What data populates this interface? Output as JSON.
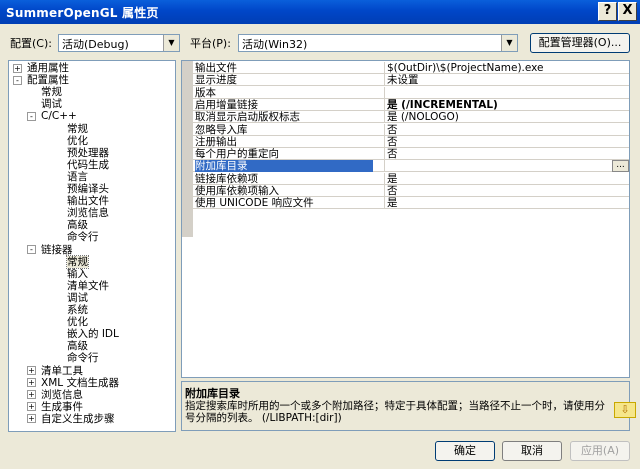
{
  "window": {
    "title": "SummerOpenGL 属性页",
    "help_label": "?",
    "close_label": "X"
  },
  "toolbar": {
    "config_label": "配置(C):",
    "config_value": "活动(Debug)",
    "platform_label": "平台(P):",
    "platform_value": "活动(Win32)",
    "config_manager_label": "配置管理器(O)..."
  },
  "tree": {
    "items": [
      {
        "label": "通用属性",
        "level": 0,
        "expander": "+"
      },
      {
        "label": "配置属性",
        "level": 0,
        "expander": "-"
      },
      {
        "label": "常规",
        "level": 1
      },
      {
        "label": "调试",
        "level": 1
      },
      {
        "label": "C/C++",
        "level": 1,
        "expander": "-"
      },
      {
        "label": "常规",
        "level": 2
      },
      {
        "label": "优化",
        "level": 2
      },
      {
        "label": "预处理器",
        "level": 2
      },
      {
        "label": "代码生成",
        "level": 2
      },
      {
        "label": "语言",
        "level": 2
      },
      {
        "label": "预编译头",
        "level": 2
      },
      {
        "label": "输出文件",
        "level": 2
      },
      {
        "label": "浏览信息",
        "level": 2
      },
      {
        "label": "高级",
        "level": 2
      },
      {
        "label": "命令行",
        "level": 2
      },
      {
        "label": "链接器",
        "level": 1,
        "expander": "-"
      },
      {
        "label": "常规",
        "level": 2,
        "selected": true
      },
      {
        "label": "输入",
        "level": 2
      },
      {
        "label": "清单文件",
        "level": 2
      },
      {
        "label": "调试",
        "level": 2
      },
      {
        "label": "系统",
        "level": 2
      },
      {
        "label": "优化",
        "level": 2
      },
      {
        "label": "嵌入的 IDL",
        "level": 2
      },
      {
        "label": "高级",
        "level": 2
      },
      {
        "label": "命令行",
        "level": 2
      },
      {
        "label": "清单工具",
        "level": 1,
        "expander": "+"
      },
      {
        "label": "XML 文档生成器",
        "level": 1,
        "expander": "+"
      },
      {
        "label": "浏览信息",
        "level": 1,
        "expander": "+"
      },
      {
        "label": "生成事件",
        "level": 1,
        "expander": "+"
      },
      {
        "label": "自定义生成步骤",
        "level": 1,
        "expander": "+"
      }
    ]
  },
  "grid": {
    "rows": [
      {
        "name": "输出文件",
        "value": "$(OutDir)\\$(ProjectName).exe"
      },
      {
        "name": "显示进度",
        "value": "未设置"
      },
      {
        "name": "版本",
        "value": ""
      },
      {
        "name": "启用增量链接",
        "value": "是 (/INCREMENTAL)",
        "bold": true
      },
      {
        "name": "取消显示启动版权标志",
        "value": "是 (/NOLOGO)"
      },
      {
        "name": "忽略导入库",
        "value": "否"
      },
      {
        "name": "注册输出",
        "value": "否"
      },
      {
        "name": "每个用户的重定向",
        "value": "否"
      },
      {
        "name": "附加库目录",
        "value": "",
        "selected": true,
        "ellipsis": "..."
      },
      {
        "name": "链接库依赖项",
        "value": "是"
      },
      {
        "name": "使用库依赖项输入",
        "value": "否"
      },
      {
        "name": "使用 UNICODE 响应文件",
        "value": "是"
      }
    ]
  },
  "description": {
    "title": "附加库目录",
    "text": "指定搜索库时所用的一个或多个附加路径；特定于具体配置；当路径不止一个时，请使用分号分隔的列表。     (/LIBPATH:[dir])"
  },
  "buttons": {
    "ok": "确定",
    "cancel": "取消",
    "apply": "应用(A)"
  },
  "colors": {
    "titlebar": "#0046C8",
    "selection": "#316AC5",
    "dialog": "#ECE9D8"
  }
}
